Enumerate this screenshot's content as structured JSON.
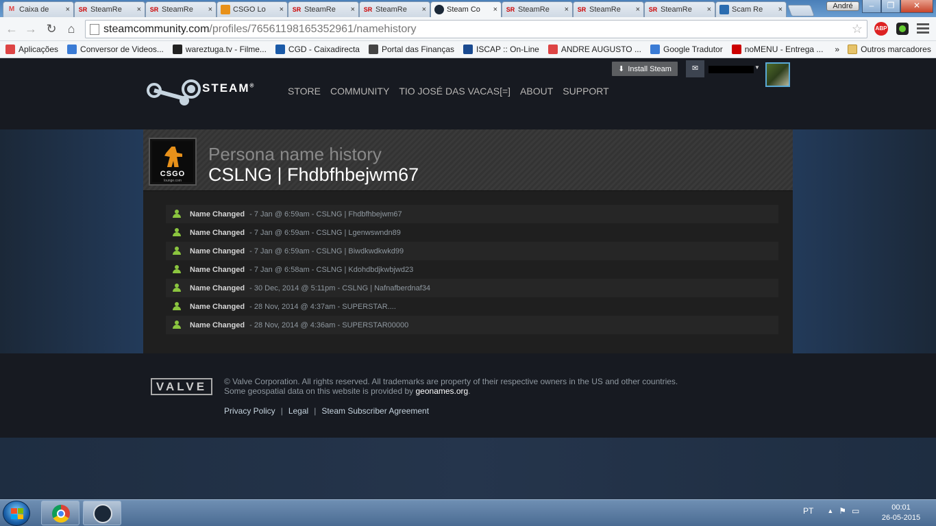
{
  "browser": {
    "tabs": [
      {
        "icon": "gmail-icon",
        "label": "Caixa de"
      },
      {
        "icon": "steamrep-icon",
        "label": "SteamRe"
      },
      {
        "icon": "steamrep-icon",
        "label": "SteamRe"
      },
      {
        "icon": "csgo-lounge-icon",
        "label": "CSGO Lo"
      },
      {
        "icon": "steamrep-icon",
        "label": "SteamRe"
      },
      {
        "icon": "steamrep-icon",
        "label": "SteamRe"
      },
      {
        "icon": "steam-icon",
        "label": "Steam Co",
        "active": true
      },
      {
        "icon": "steamrep-icon",
        "label": "SteamRe"
      },
      {
        "icon": "steamrep-icon",
        "label": "SteamRe"
      },
      {
        "icon": "steamrep-icon",
        "label": "SteamRe"
      },
      {
        "icon": "scam-icon",
        "label": "Scam Re"
      }
    ],
    "tab_icon_text": {
      "gmail": "M",
      "steamrep": "SR"
    },
    "tab_close": "×",
    "user_badge": "André",
    "window_buttons": {
      "minimize": "–",
      "maximize": "❐",
      "close": "✕"
    },
    "nav": {
      "back": "←",
      "forward": "→",
      "reload": "↻",
      "home": "⌂"
    },
    "url_host": "steamcommunity.com",
    "url_path": "/profiles/76561198165352961/namehistory",
    "star": "☆",
    "abp_label": "ABP",
    "bookmarks": [
      {
        "icon": "apps-icon",
        "label": "Aplicações",
        "color": "#d44"
      },
      {
        "icon": "ytmp3-icon",
        "label": "Conversor de Videos...",
        "color": "#3a7bd5"
      },
      {
        "icon": "wareztuga-icon",
        "label": "wareztuga.tv - Filme...",
        "color": "#222"
      },
      {
        "icon": "cgd-icon",
        "label": "CGD - Caixadirecta",
        "color": "#1a5aa8"
      },
      {
        "icon": "financas-icon",
        "label": "Portal das Finanças",
        "color": "#444"
      },
      {
        "icon": "iscap-icon",
        "label": "ISCAP :: On-Line",
        "color": "#1a4a90"
      },
      {
        "icon": "gmail-icon",
        "label": "ANDRE AUGUSTO ...",
        "color": "#d44"
      },
      {
        "icon": "translate-icon",
        "label": "Google Tradutor",
        "color": "#3a7bd5"
      },
      {
        "icon": "nomenu-icon",
        "label": "noMENU - Entrega ...",
        "color": "#c00"
      }
    ],
    "bookmarks_more": "»",
    "other_bookmarks": "Outros marcadores"
  },
  "steam": {
    "install_label": "Install Steam",
    "logo_text": "STEAM",
    "logo_reg": "®",
    "nav": [
      "STORE",
      "COMMUNITY",
      "TIO JOSÉ DAS VACAS[=]",
      "ABOUT",
      "SUPPORT"
    ]
  },
  "profile": {
    "page_title": "Persona name history",
    "name": "CSLNG | Fhdbfhbejwm67",
    "avatar_text": "CSGO",
    "avatar_sub": "lounge.com"
  },
  "history": [
    {
      "label": "Name Changed",
      "when": "7 Jan @ 6:59am",
      "name": "CSLNG | Fhdbfhbejwm67"
    },
    {
      "label": "Name Changed",
      "when": "7 Jan @ 6:59am",
      "name": "CSLNG | Lgenwswndn89"
    },
    {
      "label": "Name Changed",
      "when": "7 Jan @ 6:59am",
      "name": "CSLNG | Biwdkwdkwkd99"
    },
    {
      "label": "Name Changed",
      "when": "7 Jan @ 6:58am",
      "name": "CSLNG | Kdohdbdjkwbjwd23"
    },
    {
      "label": "Name Changed",
      "when": "30 Dec, 2014 @ 5:11pm",
      "name": "CSLNG | Nafnafberdnaf34"
    },
    {
      "label": "Name Changed",
      "when": "28 Nov, 2014 @ 4:37am",
      "name": "SUPERSTAR...."
    },
    {
      "label": "Name Changed",
      "when": "28 Nov, 2014 @ 4:36am",
      "name": "SUPERSTAR00000"
    }
  ],
  "history_sep": " - ",
  "footer": {
    "valve": "VALVE",
    "copyright_line1": "© Valve Corporation. All rights reserved. All trademarks are property of their respective owners in the US and other countries.",
    "copyright_line2_pre": "Some geospatial data on this website is provided by ",
    "geonames": "geonames.org",
    "copyright_line2_post": ".",
    "links": [
      "Privacy Policy",
      "Legal",
      "Steam Subscriber Agreement"
    ],
    "link_sep": "|"
  },
  "taskbar": {
    "lang": "PT",
    "tray_up": "▲",
    "time": "00:01",
    "date": "26-05-2015"
  },
  "colors": {
    "accent_green": "#8bc53f",
    "steam_bg": "#1b2838",
    "steam_header": "#171a21"
  }
}
